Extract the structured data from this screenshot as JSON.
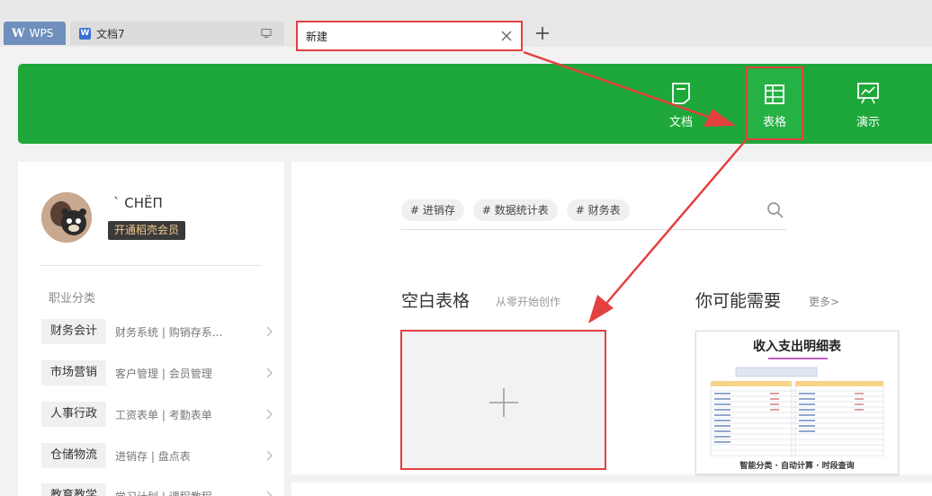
{
  "tabs": {
    "wps_label": "WPS",
    "doc_label": "文档7",
    "doc_badge": "W",
    "new_label": "新建"
  },
  "header": {
    "buttons": [
      {
        "label": "文档",
        "icon": "document-icon"
      },
      {
        "label": "表格",
        "icon": "table-icon"
      },
      {
        "label": "演示",
        "icon": "presentation-icon"
      }
    ]
  },
  "user": {
    "name": "` СНЁП",
    "member_label": "开通稻壳会员"
  },
  "categories": {
    "title": "职业分类",
    "items": [
      {
        "name": "财务会计",
        "sub": "财务系统 | 购销存系..."
      },
      {
        "name": "市场营销",
        "sub": "客户管理 | 会员管理"
      },
      {
        "name": "人事行政",
        "sub": "工资表单 | 考勤表单"
      },
      {
        "name": "仓储物流",
        "sub": "进销存 | 盘点表"
      },
      {
        "name": "教育教学",
        "sub": "学习计划 | 课程教程"
      }
    ]
  },
  "main": {
    "tags": [
      "# 进销存",
      "# 数据统计表",
      "# 财务表"
    ],
    "blank_title": "空白表格",
    "blank_subtitle": "从零开始创作",
    "need_title": "你可能需要",
    "more_label": "更多>",
    "template": {
      "title": "收入支出明细表",
      "footer": "智能分类 · 自动计算 · 时段查询"
    }
  },
  "colors": {
    "accent_green": "#1fa83a",
    "highlight_red": "#e34040",
    "wps_tab": "#6f8fbd"
  }
}
